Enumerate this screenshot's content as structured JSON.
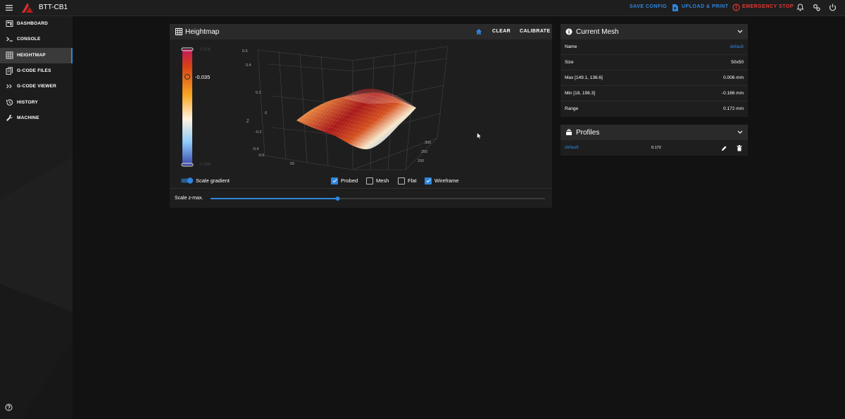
{
  "app": {
    "title": "BTT-CB1",
    "save_config": "SAVE CONFIG",
    "upload_print": "UPLOAD & PRINT",
    "emergency_stop": "EMERGENCY STOP"
  },
  "colors": {
    "accent": "#2e86de",
    "danger": "#e53935",
    "card": "#1e1e1e",
    "header": "#2a2a2a"
  },
  "sidebar": {
    "items": [
      {
        "label": "DASHBOARD",
        "icon": "dashboard-icon",
        "active": false
      },
      {
        "label": "CONSOLE",
        "icon": "console-icon",
        "active": false
      },
      {
        "label": "HEIGHTMAP",
        "icon": "grid-icon",
        "active": true
      },
      {
        "label": "G-CODE FILES",
        "icon": "files-icon",
        "active": false
      },
      {
        "label": "G-CODE VIEWER",
        "icon": "viewer-icon",
        "active": false
      },
      {
        "label": "HISTORY",
        "icon": "history-icon",
        "active": false
      },
      {
        "label": "MACHINE",
        "icon": "wrench-icon",
        "active": false
      }
    ]
  },
  "heightmap": {
    "title": "Heightmap",
    "clear": "CLEAR",
    "calibrate": "CALIBRATE",
    "gradient": {
      "max": "0.006",
      "mid": "-0.035",
      "min": "-0.166"
    },
    "scale_gradient_label": "Scale gradient",
    "scale_gradient_on": true,
    "options": [
      {
        "label": "Probed",
        "checked": true
      },
      {
        "label": "Mesh",
        "checked": false
      },
      {
        "label": "Flat",
        "checked": false
      },
      {
        "label": "Wireframe",
        "checked": true
      }
    ],
    "scale_zmax_label": "Scale z-max.",
    "scale_zmax_value": 0.38,
    "z_axis_label": "Z",
    "z_ticks": [
      "0.5",
      "0.4",
      "0.2",
      "0",
      "-0.2",
      "-0.4",
      "-0.6"
    ],
    "x_ticks": [
      "50"
    ],
    "y_ticks": [
      "300",
      "250",
      "200"
    ]
  },
  "current_mesh": {
    "title": "Current Mesh",
    "rows": [
      {
        "key": "Name",
        "value": "default",
        "link": true
      },
      {
        "key": "Size",
        "value": "50x50",
        "link": false
      },
      {
        "key": "Max [149.1, 136.6]",
        "value": "0.006 mm",
        "link": false
      },
      {
        "key": "Min [18, 196.3]",
        "value": "-0.166 mm",
        "link": false
      },
      {
        "key": "Range",
        "value": "0.172 mm",
        "link": false
      }
    ]
  },
  "profiles": {
    "title": "Profiles",
    "items": [
      {
        "name": "default",
        "range": "0.172"
      }
    ]
  }
}
